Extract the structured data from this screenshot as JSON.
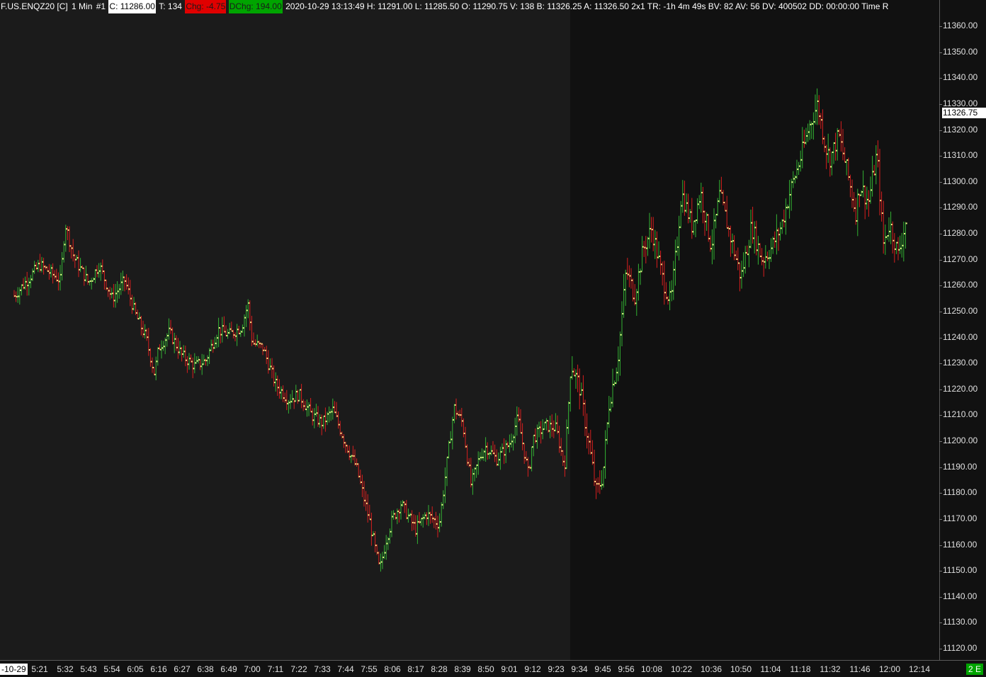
{
  "header": {
    "symbol": "F.US.ENQZ20 [C]",
    "interval": "1 Min",
    "chart_number": "#1",
    "close": "C: 11286.00",
    "ticks": "T: 134",
    "change": "Chg: -4.75",
    "day_change": "DChg: 194.00",
    "details": "2020-10-29 13:13:49 H: 11291.00 L: 11285.50 O: 11290.75 V: 138 B: 11326.25 A: 11326.50 2x1 TR: -1h 4m 49s BV: 82 AV: 56 DV: 400502 DD: 00:00:00 Time R"
  },
  "colors": {
    "background": "#111111",
    "session_background": "#1b1b1b",
    "up_bar": "#33b233",
    "down_bar": "#d81e1e",
    "close_dot": "#f4f48c"
  },
  "price_axis": {
    "ticks": [
      "11360.00",
      "11350.00",
      "11340.00",
      "11330.00",
      "11320.00",
      "11310.00",
      "11300.00",
      "11290.00",
      "11280.00",
      "11270.00",
      "11260.00",
      "11250.00",
      "11240.00",
      "11230.00",
      "11220.00",
      "11210.00",
      "11200.00",
      "11190.00",
      "11180.00",
      "11170.00",
      "11160.00",
      "11150.00",
      "11140.00",
      "11130.00",
      "11120.00"
    ],
    "last_price_label": "11326.75"
  },
  "time_axis": {
    "date_badge": "-10-29",
    "ticks": [
      "5:21",
      "5:32",
      "5:43",
      "5:54",
      "6:05",
      "6:16",
      "6:27",
      "6:38",
      "6:49",
      "7:00",
      "7:11",
      "7:22",
      "7:33",
      "7:44",
      "7:55",
      "8:06",
      "8:17",
      "8:28",
      "8:39",
      "8:50",
      "9:01",
      "9:12",
      "9:23",
      "9:34",
      "9:45",
      "9:56",
      "10:08",
      "10:22",
      "10:36",
      "10:50",
      "11:04",
      "11:18",
      "11:32",
      "11:46",
      "12:00",
      "12:14"
    ],
    "corner_badge": "2 E"
  },
  "chart_data": {
    "type": "ohlc",
    "symbol": "F.US.ENQZ20",
    "interval": "1 Min",
    "ylim": [
      11115,
      11365
    ],
    "session_break_x": "9:30",
    "series": [
      {
        "x": "5:10",
        "close": 11256
      },
      {
        "x": "5:21",
        "close": 11268
      },
      {
        "x": "5:30",
        "close": 11262
      },
      {
        "x": "5:32",
        "close": 11284
      },
      {
        "x": "5:36",
        "close": 11271
      },
      {
        "x": "5:43",
        "close": 11261
      },
      {
        "x": "5:48",
        "close": 11268
      },
      {
        "x": "5:54",
        "close": 11255
      },
      {
        "x": "6:00",
        "close": 11262
      },
      {
        "x": "6:05",
        "close": 11249
      },
      {
        "x": "6:10",
        "close": 11240
      },
      {
        "x": "6:14",
        "close": 11226
      },
      {
        "x": "6:16",
        "close": 11236
      },
      {
        "x": "6:21",
        "close": 11242
      },
      {
        "x": "6:27",
        "close": 11233
      },
      {
        "x": "6:33",
        "close": 11229
      },
      {
        "x": "6:38",
        "close": 11231
      },
      {
        "x": "6:44",
        "close": 11243
      },
      {
        "x": "6:49",
        "close": 11241
      },
      {
        "x": "6:55",
        "close": 11244
      },
      {
        "x": "6:58",
        "close": 11253
      },
      {
        "x": "7:00",
        "close": 11238
      },
      {
        "x": "7:05",
        "close": 11236
      },
      {
        "x": "7:11",
        "close": 11222
      },
      {
        "x": "7:17",
        "close": 11216
      },
      {
        "x": "7:22",
        "close": 11218
      },
      {
        "x": "7:28",
        "close": 11210
      },
      {
        "x": "7:33",
        "close": 11207
      },
      {
        "x": "7:38",
        "close": 11212
      },
      {
        "x": "7:44",
        "close": 11199
      },
      {
        "x": "7:49",
        "close": 11190
      },
      {
        "x": "7:52",
        "close": 11180
      },
      {
        "x": "7:55",
        "close": 11170
      },
      {
        "x": "8:00",
        "close": 11150
      },
      {
        "x": "8:03",
        "close": 11162
      },
      {
        "x": "8:06",
        "close": 11170
      },
      {
        "x": "8:10",
        "close": 11176
      },
      {
        "x": "8:17",
        "close": 11166
      },
      {
        "x": "8:22",
        "close": 11172
      },
      {
        "x": "8:28",
        "close": 11168
      },
      {
        "x": "8:32",
        "close": 11194
      },
      {
        "x": "8:35",
        "close": 11213
      },
      {
        "x": "8:39",
        "close": 11207
      },
      {
        "x": "8:43",
        "close": 11183
      },
      {
        "x": "8:47",
        "close": 11194
      },
      {
        "x": "8:50",
        "close": 11198
      },
      {
        "x": "8:55",
        "close": 11193
      },
      {
        "x": "9:01",
        "close": 11199
      },
      {
        "x": "9:05",
        "close": 11209
      },
      {
        "x": "9:10",
        "close": 11187
      },
      {
        "x": "9:12",
        "close": 11201
      },
      {
        "x": "9:18",
        "close": 11206
      },
      {
        "x": "9:23",
        "close": 11205
      },
      {
        "x": "9:27",
        "close": 11190
      },
      {
        "x": "9:30",
        "close": 11230
      },
      {
        "x": "9:34",
        "close": 11221
      },
      {
        "x": "9:38",
        "close": 11201
      },
      {
        "x": "9:42",
        "close": 11180
      },
      {
        "x": "9:45",
        "close": 11187
      },
      {
        "x": "9:48",
        "close": 11215
      },
      {
        "x": "9:52",
        "close": 11231
      },
      {
        "x": "9:56",
        "close": 11266
      },
      {
        "x": "10:00",
        "close": 11256
      },
      {
        "x": "10:04",
        "close": 11274
      },
      {
        "x": "10:08",
        "close": 11282
      },
      {
        "x": "10:13",
        "close": 11263
      },
      {
        "x": "10:17",
        "close": 11253
      },
      {
        "x": "10:20",
        "close": 11277
      },
      {
        "x": "10:22",
        "close": 11296
      },
      {
        "x": "10:27",
        "close": 11283
      },
      {
        "x": "10:31",
        "close": 11296
      },
      {
        "x": "10:36",
        "close": 11275
      },
      {
        "x": "10:40",
        "close": 11295
      },
      {
        "x": "10:45",
        "close": 11279
      },
      {
        "x": "10:50",
        "close": 11263
      },
      {
        "x": "10:55",
        "close": 11283
      },
      {
        "x": "11:00",
        "close": 11270
      },
      {
        "x": "11:04",
        "close": 11274
      },
      {
        "x": "11:09",
        "close": 11283
      },
      {
        "x": "11:13",
        "close": 11296
      },
      {
        "x": "11:18",
        "close": 11309
      },
      {
        "x": "11:22",
        "close": 11321
      },
      {
        "x": "11:26",
        "close": 11330
      },
      {
        "x": "11:30",
        "close": 11313
      },
      {
        "x": "11:32",
        "close": 11309
      },
      {
        "x": "11:36",
        "close": 11318
      },
      {
        "x": "11:40",
        "close": 11304
      },
      {
        "x": "11:44",
        "close": 11288
      },
      {
        "x": "11:46",
        "close": 11299
      },
      {
        "x": "11:50",
        "close": 11292
      },
      {
        "x": "11:54",
        "close": 11311
      },
      {
        "x": "11:57",
        "close": 11276
      },
      {
        "x": "12:00",
        "close": 11284
      },
      {
        "x": "12:04",
        "close": 11272
      },
      {
        "x": "12:08",
        "close": 11286
      }
    ]
  }
}
